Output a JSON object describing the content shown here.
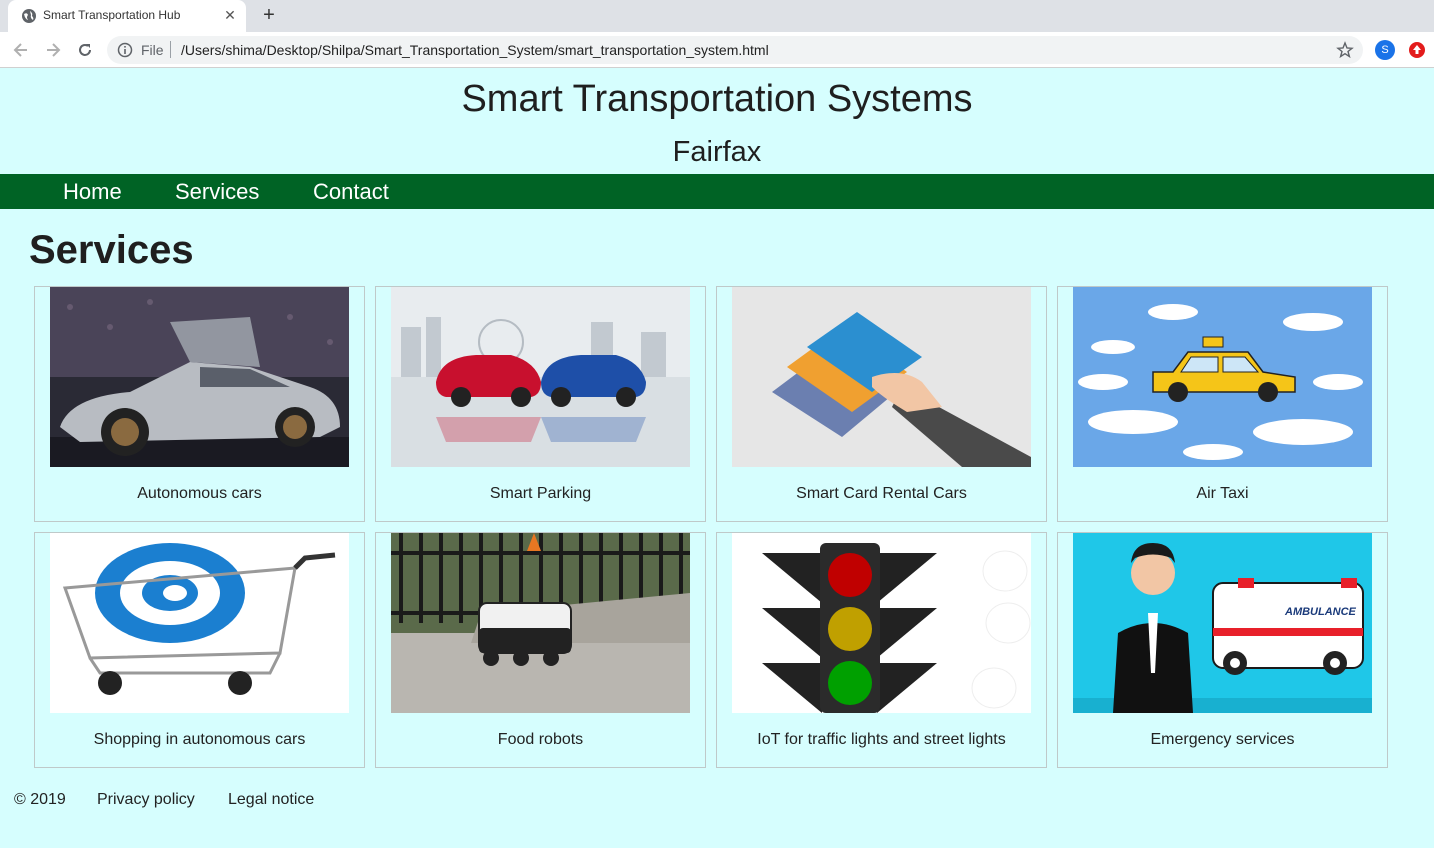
{
  "browser": {
    "tab_title": "Smart Transportation Hub",
    "scheme_label": "File",
    "url": "/Users/shima/Desktop/Shilpa/Smart_Transportation_System/smart_transportation_system.html",
    "profile_initial": "S"
  },
  "header": {
    "title": "Smart Transportation Systems",
    "subtitle": "Fairfax"
  },
  "nav": {
    "items": [
      "Home",
      "Services",
      "Contact"
    ]
  },
  "main": {
    "heading": "Services",
    "cards": [
      {
        "caption": "Autonomous cars"
      },
      {
        "caption": "Smart Parking"
      },
      {
        "caption": "Smart Card Rental Cars"
      },
      {
        "caption": "Air Taxi"
      },
      {
        "caption": "Shopping in autonomous cars"
      },
      {
        "caption": "Food robots"
      },
      {
        "caption": "IoT for traffic lights and street lights"
      },
      {
        "caption": "Emergency services"
      }
    ]
  },
  "images": {
    "ambulance_label": "AMBULANCE"
  },
  "footer": {
    "copyright": "© 2019",
    "privacy": "Privacy policy",
    "legal": "Legal notice"
  },
  "colors": {
    "page_bg": "#d6fefe",
    "nav_bg": "#006325",
    "nav_text": "#ffffff"
  }
}
